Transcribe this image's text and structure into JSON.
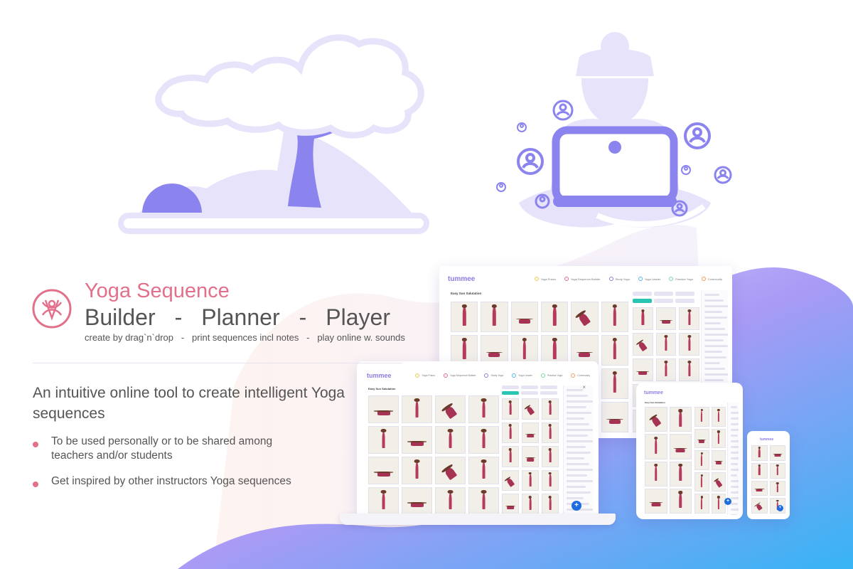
{
  "brand": {
    "title_line1": "Yoga Sequence",
    "title_line2": [
      "Builder",
      "-",
      "Planner",
      "-",
      "Player"
    ],
    "subtitle": "create by drag`n`drop   -   print sequences incl notes   -   play online w. sounds"
  },
  "headline": "An intuitive online tool to create intelligent Yoga sequences",
  "bullets": [
    "To be used personally or to be shared among teachers and/or students",
    "Get inspired by other instructors Yoga sequences"
  ],
  "app": {
    "logo": "tummee",
    "nav": [
      "Yoga Poses",
      "Yoga Sequence Builder",
      "Study Yoga",
      "Yoga Leader",
      "Practice Yoga",
      "Community"
    ],
    "sequence_title": "Easy Sun Salutation",
    "close_symbol": "×",
    "add_symbol": "+"
  },
  "colors": {
    "accent_pink": "#e2708a",
    "accent_purple": "#8a7ee6",
    "illustration_light": "#e6e3fb",
    "illustration_mid": "#8b84ef",
    "text_gray": "#555555",
    "teal": "#2ac4b3",
    "fab_blue": "#1e6de0"
  },
  "icons": [
    "tree-illustration",
    "meditating-person-laptop-illustration",
    "user-avatar-icon",
    "yoga-logo-icon"
  ]
}
